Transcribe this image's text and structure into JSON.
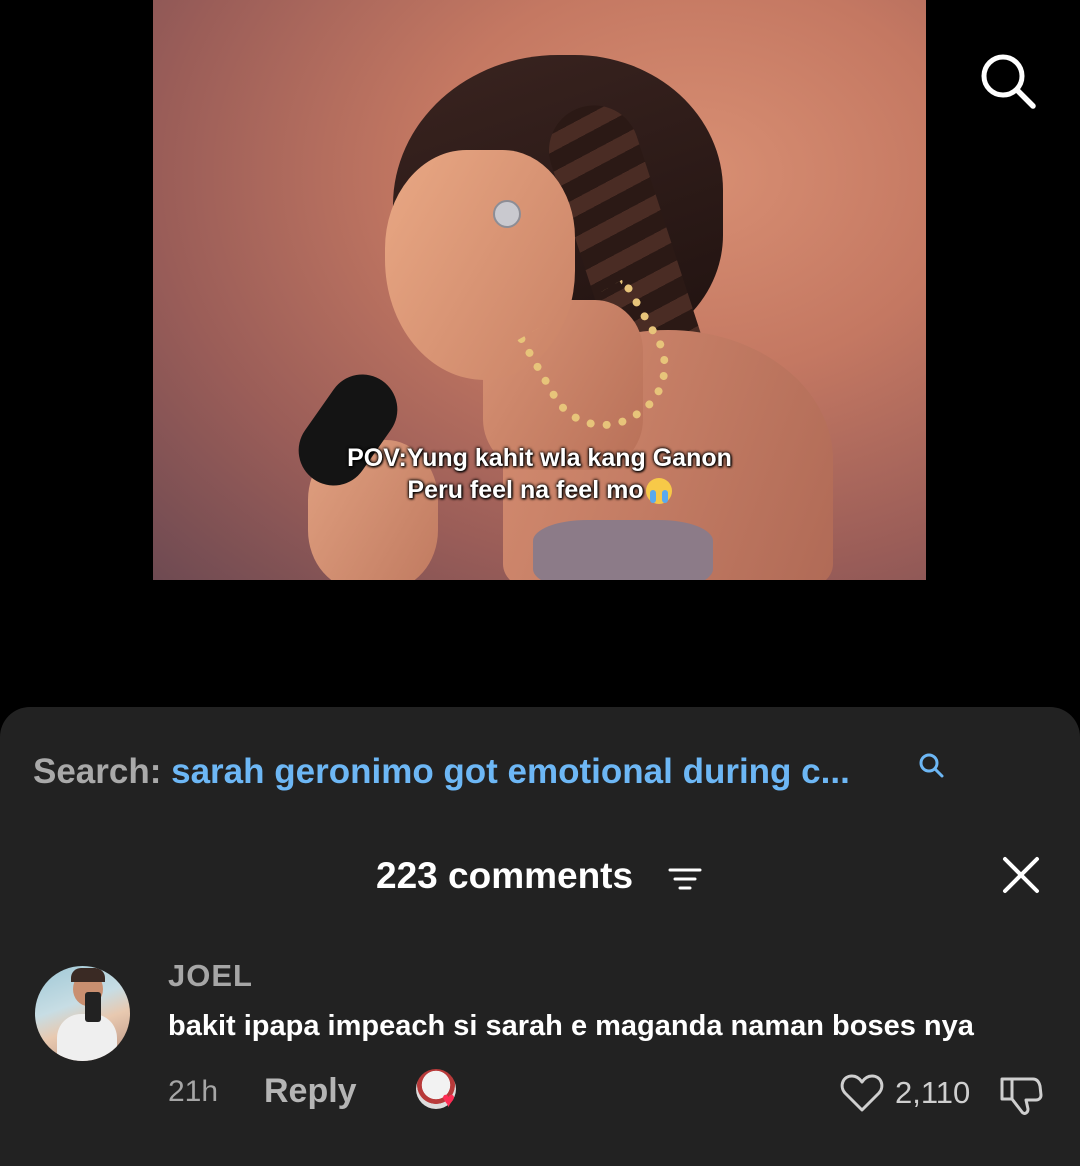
{
  "video": {
    "caption_line1": "POV:Yung kahit wla kang Ganon",
    "caption_line2": "Peru feel na feel mo"
  },
  "header": {
    "search_icon": "search-icon"
  },
  "search": {
    "label": "Search: ",
    "query": "sarah geronimo got emotional during c...",
    "icon": "search-icon"
  },
  "comments": {
    "title": "223 comments",
    "sort_icon": "sort-icon",
    "close_icon": "close-icon",
    "items": [
      {
        "username": "JOEL",
        "text": "bakit ipapa impeach si sarah e maganda naman boses nya",
        "time": "21h",
        "reply_label": "Reply",
        "likes": "2,110",
        "liked_by_creator": true
      }
    ]
  },
  "colors": {
    "background": "#000000",
    "sheet": "#222222",
    "query_link": "#6db7f5",
    "muted_text": "#a6a6a6",
    "heart_accent": "#ff2d55"
  }
}
